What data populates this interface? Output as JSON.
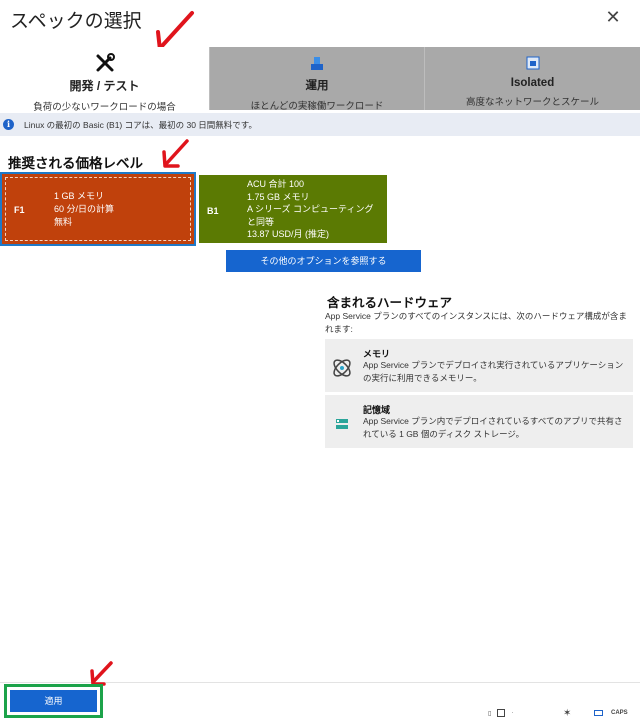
{
  "dialog": {
    "title": "スペックの選択",
    "close_icon": "close-icon"
  },
  "tabs": [
    {
      "name": "開発 / テスト",
      "desc": "負荷の少ないワークロードの場合",
      "icon": "tools-icon"
    },
    {
      "name": "運用",
      "desc": "ほとんどの実稼働ワークロード",
      "icon": "production-icon"
    },
    {
      "name": "Isolated",
      "desc": "高度なネットワークとスケール",
      "icon": "isolated-icon"
    }
  ],
  "info": {
    "text": "Linux の最初の Basic (B1) コアは、最初の 30 日間無料です。",
    "icon": "info-icon"
  },
  "pricing": {
    "title": "推奨される価格レベル",
    "tiers": [
      {
        "code": "F1",
        "lines": [
          "1 GB メモリ",
          "60 分/日の計算",
          "無料"
        ],
        "color": "#c0410c"
      },
      {
        "code": "B1",
        "lines": [
          "ACU 合計 100",
          "1.75 GB メモリ",
          "A シリーズ コンピューティング",
          "と同等",
          "13.87 USD/月 (推定)"
        ],
        "color": "#5b7a03"
      }
    ],
    "more_options": "その他のオプションを参照する"
  },
  "hardware": {
    "title": "含まれるハードウェア",
    "desc": "App Service プランのすべてのインスタンスには、次のハードウェア構成が含まれます:",
    "items": [
      {
        "name": "メモリ",
        "desc": "App Service プランでデプロイされ実行されているアプリケーションの実行に利用できるメモリー。",
        "icon": "memory-icon"
      },
      {
        "name": "記憶域",
        "desc": "App Service プラン内でデプロイされているすべてのアプリで共有されている 1 GB 個のディスク ストレージ。",
        "icon": "storage-icon"
      }
    ]
  },
  "footer": {
    "apply": "適用"
  },
  "tray": {
    "caps": "CAPS"
  },
  "colors": {
    "accent": "#1665cf",
    "annotation_arrow": "#e0141c",
    "apply_outline": "#1ca34a",
    "selected_outline": "#1f79c8"
  }
}
